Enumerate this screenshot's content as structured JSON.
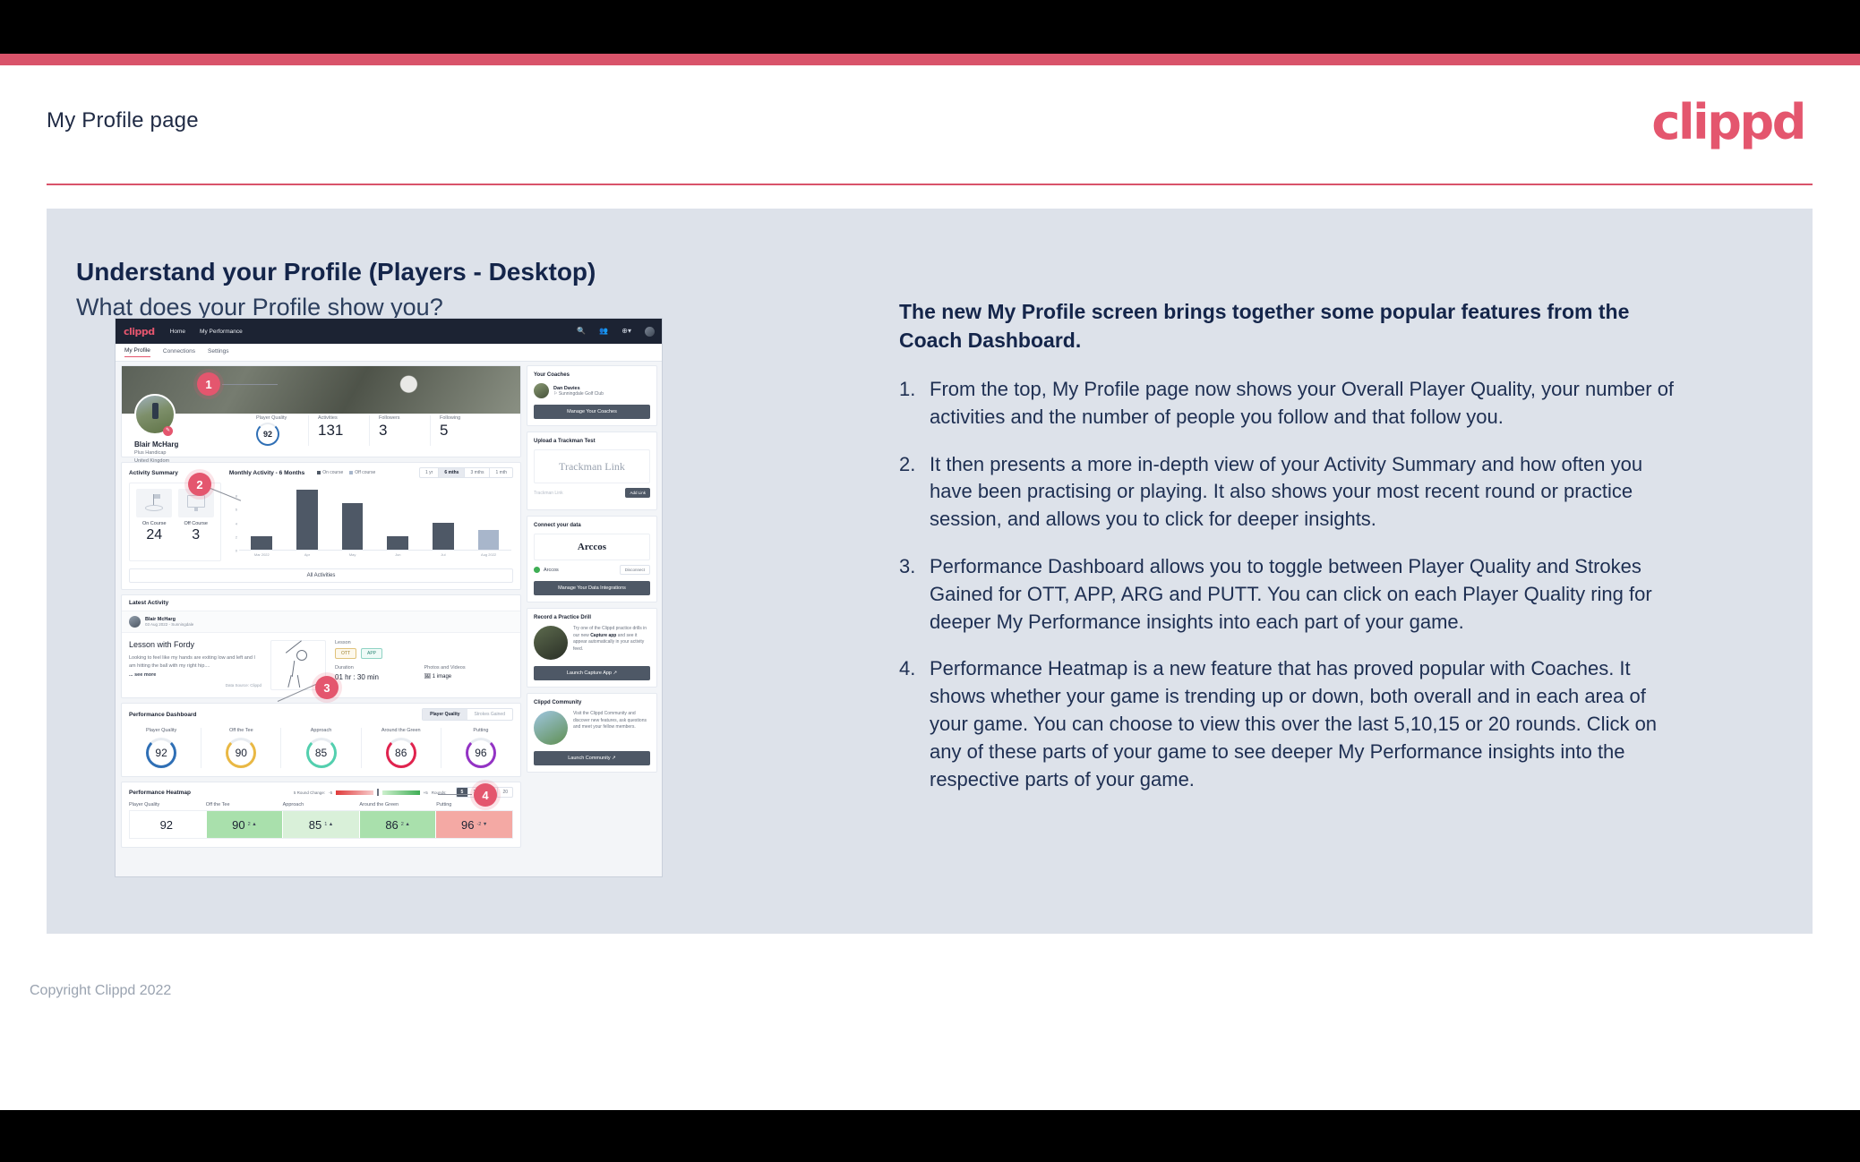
{
  "header": {
    "title": "My Profile page",
    "brand": "clippd"
  },
  "slide": {
    "title": "Understand your Profile (Players - Desktop)",
    "subtitle": "What does your Profile show you?",
    "footer": "Copyright Clippd 2022"
  },
  "explainer": {
    "lead": "The new My Profile screen brings together some popular features from the Coach Dashboard.",
    "items": [
      {
        "num": "1.",
        "text": "From the top, My Profile page now shows your Overall Player Quality, your number of activities and the number of people you follow and that follow you."
      },
      {
        "num": "2.",
        "text": "It then presents a more in-depth view of your Activity Summary and how often you have been practising or playing. It also shows your most recent round or practice session, and allows you to click for deeper insights."
      },
      {
        "num": "3.",
        "text": "Performance Dashboard allows you to toggle between Player Quality and Strokes Gained for OTT, APP, ARG and PUTT. You can click on each Player Quality ring for deeper My Performance insights into each part of your game."
      },
      {
        "num": "4.",
        "text": "Performance Heatmap is a new feature that has proved popular with Coaches. It shows whether your game is trending up or down, both overall and in each area of your game. You can choose to view this over the last 5,10,15 or 20 rounds. Click on any of these parts of your game to see deeper My Performance insights into the respective parts of your game."
      }
    ]
  },
  "callouts": [
    "1",
    "2",
    "3",
    "4"
  ],
  "app": {
    "brand": "clippd",
    "nav": [
      "Home",
      "My Performance"
    ],
    "nav_icons": [
      "search-icon",
      "people-icon",
      "add-circle-icon",
      "avatar-icon"
    ],
    "tabs": [
      {
        "label": "My Profile",
        "active": true
      },
      {
        "label": "Connections",
        "active": false
      },
      {
        "label": "Settings",
        "active": false
      }
    ],
    "profile": {
      "name": "Blair McHarg",
      "handicap": "Plus Handicap",
      "location": "United Kingdom",
      "player_quality_label": "Player Quality",
      "player_quality": "92",
      "stats": [
        {
          "label": "Activities",
          "value": "131"
        },
        {
          "label": "Followers",
          "value": "3"
        },
        {
          "label": "Following",
          "value": "5"
        }
      ]
    },
    "activity_summary": {
      "title": "Activity Summary",
      "chart_title": "Monthly Activity - 6 Months",
      "legend": [
        "On course",
        "Off course"
      ],
      "ranges": [
        {
          "label": "1 yr",
          "active": false
        },
        {
          "label": "6 mths",
          "active": true
        },
        {
          "label": "3 mths",
          "active": false
        },
        {
          "label": "1 mth",
          "active": false
        }
      ],
      "tiles": [
        {
          "label": "On Course",
          "value": "24",
          "icon": "golf-flag-icon"
        },
        {
          "label": "Off Course",
          "value": "3",
          "icon": "monitor-icon"
        }
      ],
      "all_activities": "All Activities"
    },
    "latest_activity": {
      "title": "Latest Activity",
      "user": "Blair McHarg",
      "date": "03 Aug 2022 - Sunningdale",
      "post_title": "Lesson with Fordy",
      "post_body": "Looking to feel like my hands are exiting low and left and I am hitting the ball with my right hip....",
      "see_more": "... see more",
      "source": "Data Source: Clippd",
      "lesson_label": "Lesson",
      "tags": [
        "OTT",
        "APP"
      ],
      "duration_label": "Duration",
      "duration": "01 hr : 30 min",
      "media_label": "Photos and Videos",
      "media": "1 image"
    },
    "performance_dashboard": {
      "title": "Performance Dashboard",
      "toggle": [
        {
          "label": "Player Quality",
          "active": true
        },
        {
          "label": "Strokes Gained",
          "active": false
        }
      ],
      "rings": [
        {
          "label": "Player Quality",
          "value": "92",
          "color": "#2f6fb5"
        },
        {
          "label": "Off the Tee",
          "value": "90",
          "color": "#e9b844"
        },
        {
          "label": "Approach",
          "value": "85",
          "color": "#53cfae"
        },
        {
          "label": "Around the Green",
          "value": "86",
          "color": "#e0234e"
        },
        {
          "label": "Putting",
          "value": "96",
          "color": "#9333c4"
        }
      ]
    },
    "heatmap": {
      "title": "Performance Heatmap",
      "legend_label": "5 Round Change:",
      "legend_min": "-5",
      "legend_max": "+5",
      "rounds_label": "Rounds:",
      "rounds": [
        {
          "label": "5",
          "active": true
        },
        {
          "label": "10",
          "active": false
        },
        {
          "label": "15",
          "active": false
        },
        {
          "label": "20",
          "active": false
        }
      ],
      "cells": [
        {
          "label": "Player Quality",
          "value": "92",
          "delta": "",
          "bg": "#ffffff"
        },
        {
          "label": "Off the Tee",
          "value": "90",
          "delta": "2 ▲",
          "bg": "#a9e0ac"
        },
        {
          "label": "Approach",
          "value": "85",
          "delta": "1 ▲",
          "bg": "#d9f0d9"
        },
        {
          "label": "Around the Green",
          "value": "86",
          "delta": "2 ▲",
          "bg": "#a9e0ac"
        },
        {
          "label": "Putting",
          "value": "96",
          "delta": "-2 ▼",
          "bg": "#f4a9a4"
        }
      ]
    },
    "sidebar": {
      "coaches": {
        "title": "Your Coaches",
        "name": "Dan Davies",
        "club": "Sunningdale Golf Club",
        "button": "Manage Your Coaches"
      },
      "trackman": {
        "title": "Upload a Trackman Test",
        "brand": "Trackman Link",
        "placeholder": "Trackman Link",
        "button": "Add Link"
      },
      "data": {
        "title": "Connect your data",
        "brand": "Arccos",
        "source": "Arccos",
        "disconnect": "Disconnect",
        "button": "Manage Your Data Integrations"
      },
      "drill": {
        "title": "Record a Practice Drill",
        "body_1": "Try one of the Clippd practice drills in our new ",
        "body_bold": "Capture app",
        "body_2": " and see it appear automatically in your activity feed.",
        "button": "Launch Capture App"
      },
      "community": {
        "title": "Clippd Community",
        "body": "Visit the Clippd Community and discover new features, ask questions and meet your fellow members.",
        "button": "Launch Community"
      }
    }
  },
  "chart_data": {
    "type": "bar",
    "title": "Monthly Activity - 6 Months",
    "categories": [
      "Mar 2022",
      "Apr",
      "May",
      "Jun",
      "Jul",
      "Aug 2022"
    ],
    "values": [
      2,
      9,
      7,
      2,
      4,
      3
    ],
    "series": [
      {
        "name": "On course",
        "values": [
          2,
          9,
          7,
          2,
          4,
          0
        ],
        "color": "#4e5866"
      },
      {
        "name": "Off course",
        "values": [
          0,
          0,
          0,
          0,
          0,
          3
        ],
        "color": "#a8b6cb"
      }
    ],
    "xlabel": "",
    "ylabel": "",
    "ylim": [
      0,
      10
    ],
    "yticks": [
      0,
      2,
      4,
      6,
      8
    ],
    "grid": false,
    "legend": "top-right"
  }
}
